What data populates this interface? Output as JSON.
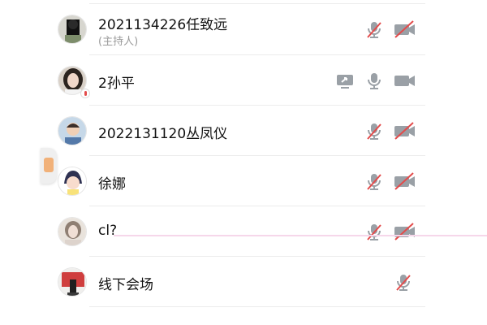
{
  "participants": [
    {
      "name": "2021134226任致远",
      "role": "(主持人)",
      "icons": [
        "mic-muted-icon",
        "camera-off-icon"
      ]
    },
    {
      "name": "2孙平",
      "role": "",
      "icons": [
        "screen-share-icon",
        "mic-icon",
        "camera-icon"
      ]
    },
    {
      "name": "2022131120丛凤仪",
      "role": "",
      "icons": [
        "mic-muted-icon",
        "camera-off-icon"
      ]
    },
    {
      "name": "徐娜",
      "role": "",
      "icons": [
        "mic-muted-icon",
        "camera-off-icon"
      ]
    },
    {
      "name": "cl?",
      "role": "",
      "icons": [
        "mic-muted-icon",
        "camera-off-icon"
      ]
    },
    {
      "name": "线下会场",
      "role": "",
      "icons": [
        "mic-muted-icon"
      ]
    }
  ],
  "colors": {
    "muted_slash": "#e34b4b",
    "icon_gray": "#9aa0a6",
    "divider": "#ececec"
  }
}
